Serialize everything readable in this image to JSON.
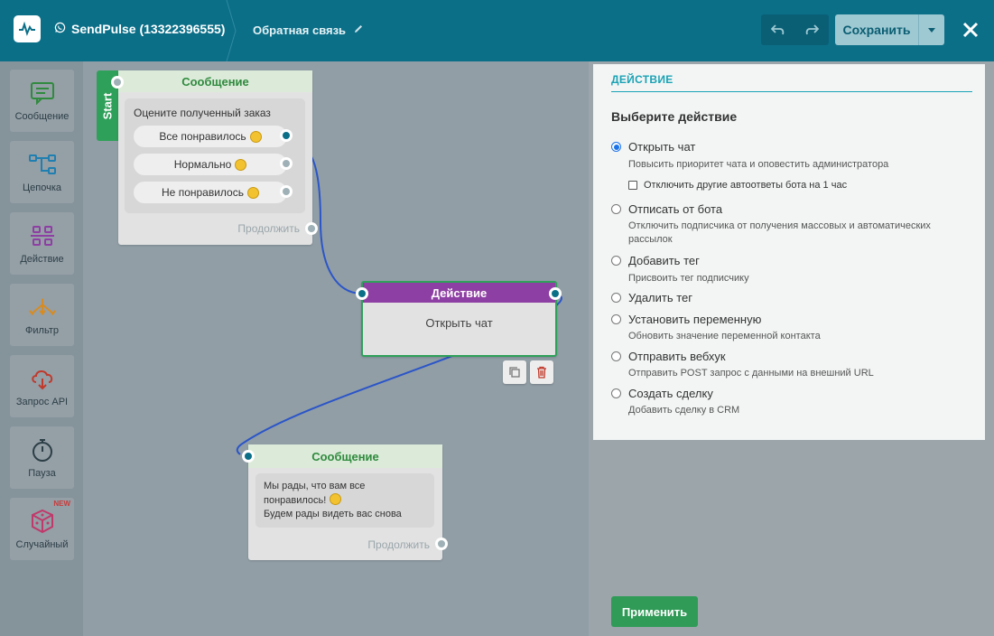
{
  "header": {
    "project_name": "SendPulse (13322396555)",
    "flow_name": "Обратная связь",
    "save_label": "Сохранить",
    "colors": {
      "bar": "#0b6f88",
      "save_bg": "#9ec9d3"
    }
  },
  "toolbox": {
    "items": [
      {
        "label": "Сообщение",
        "icon": "message-icon"
      },
      {
        "label": "Цепочка",
        "icon": "chain-icon"
      },
      {
        "label": "Действие",
        "icon": "action-icon"
      },
      {
        "label": "Фильтр",
        "icon": "filter-icon"
      },
      {
        "label": "Запрос API",
        "icon": "api-icon"
      },
      {
        "label": "Пауза",
        "icon": "timer-icon"
      },
      {
        "label": "Случайный",
        "icon": "dice-icon",
        "badge": "NEW"
      }
    ]
  },
  "canvas": {
    "start_label": "Start",
    "node1": {
      "title": "Сообщение",
      "question": "Оцените полученный заказ",
      "buttons": [
        "Все понравилось",
        "Нормально",
        "Не понравилось"
      ],
      "continue": "Продолжить"
    },
    "action_node": {
      "title": "Действие",
      "body": "Открыть чат"
    },
    "node2": {
      "title": "Сообщение",
      "text_line1": "Мы рады, что вам все",
      "text_line2": "понравилось!",
      "text_line3": "Будем рады видеть вас снова",
      "continue": "Продолжить"
    }
  },
  "panel": {
    "title": "ДЕЙСТВИЕ",
    "subtitle": "Выберите действие",
    "options": [
      {
        "label": "Открыть чат",
        "desc": "Повысить приоритет чата и оповестить администратора",
        "selected": true
      },
      {
        "label": "Отписать от бота",
        "desc": "Отключить подписчика от получения массовых и автоматических рассылок",
        "selected": false
      },
      {
        "label": "Добавить тег",
        "desc": "Присвоить тег подписчику",
        "selected": false
      },
      {
        "label": "Удалить тег",
        "desc": "",
        "selected": false
      },
      {
        "label": "Установить переменную",
        "desc": "Обновить значение переменной контакта",
        "selected": false
      },
      {
        "label": "Отправить вебхук",
        "desc": "Отправить POST запрос с данными на внешний URL",
        "selected": false
      },
      {
        "label": "Создать сделку",
        "desc": "Добавить сделку в CRM",
        "selected": false
      }
    ],
    "checkbox_label": "Отключить другие автоответы бота на 1 час",
    "apply_label": "Применить"
  }
}
